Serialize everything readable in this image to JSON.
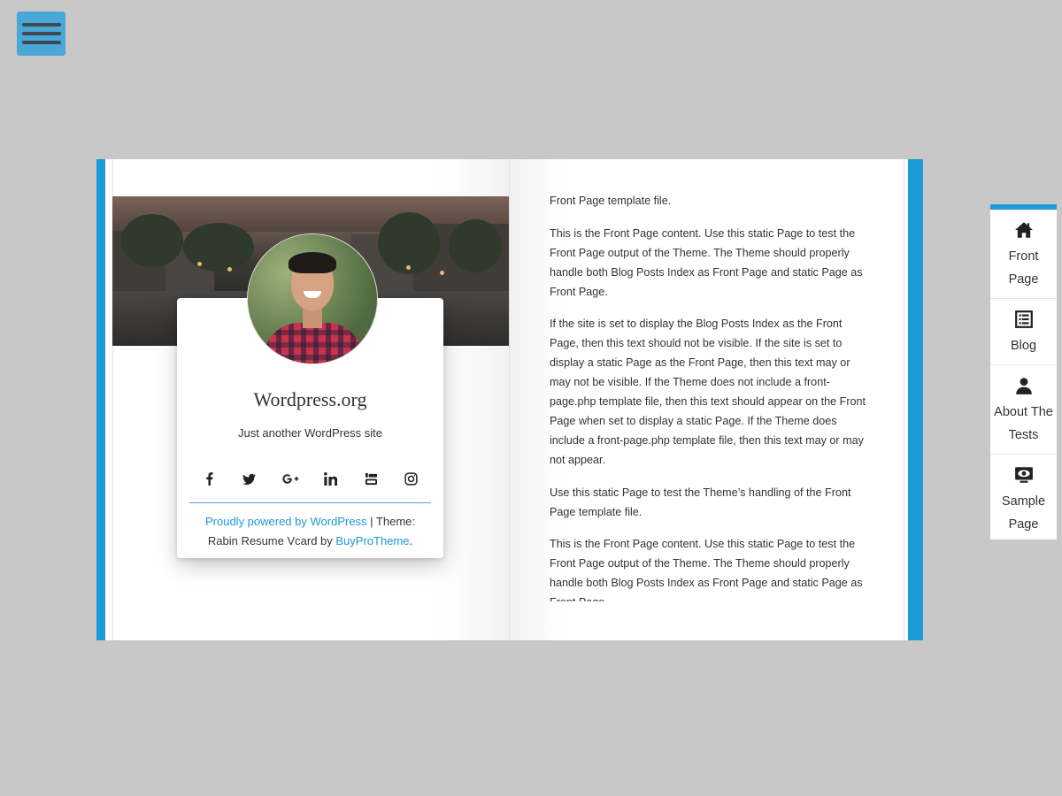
{
  "menu": {
    "icon": "hamburger-icon"
  },
  "colors": {
    "accent": "#1a9ad8",
    "menu_button": "#4aa8d8",
    "background": "#c8c8c8"
  },
  "profile": {
    "site_title": "Wordpress.org",
    "tagline": "Just another WordPress site",
    "social_icons": [
      "facebook-icon",
      "twitter-icon",
      "google-plus-icon",
      "linkedin-icon",
      "youtube-icon",
      "instagram-icon"
    ],
    "credits": {
      "powered_link": "Proudly powered by WordPress",
      "separator": " | Theme:",
      "theme_prefix": "Rabin Resume Vcard by ",
      "theme_link": "BuyProTheme",
      "theme_suffix": "."
    }
  },
  "content": {
    "paragraphs": [
      "Front Page template file.",
      "This is the Front Page content. Use this static Page to test the Front Page output of the Theme. The Theme should properly handle both Blog Posts Index as Front Page and static Page as Front Page.",
      "If the site is set to display the Blog Posts Index as the Front Page, then this text should not be visible. If the site is set to display a static Page as the Front Page, then this text may or may not be visible. If the Theme does not include a front-page.php template file, then this text should appear on the Front Page when set to display a static Page. If the Theme does include a front-page.php template file, then this text may or may not appear.",
      "Use this static Page to test the Theme’s handling of the Front Page template file.",
      "This is the Front Page content. Use this static Page to test the Front Page output of the Theme. The Theme should properly handle both Blog Posts Index as Front Page and static Page as Front Page."
    ]
  },
  "side_nav": [
    {
      "label": "Front Page",
      "icon": "home-icon"
    },
    {
      "label": "Blog",
      "icon": "list-icon"
    },
    {
      "label": "About The Tests",
      "icon": "user-icon"
    },
    {
      "label": "Sample Page",
      "icon": "eye-icon"
    }
  ]
}
